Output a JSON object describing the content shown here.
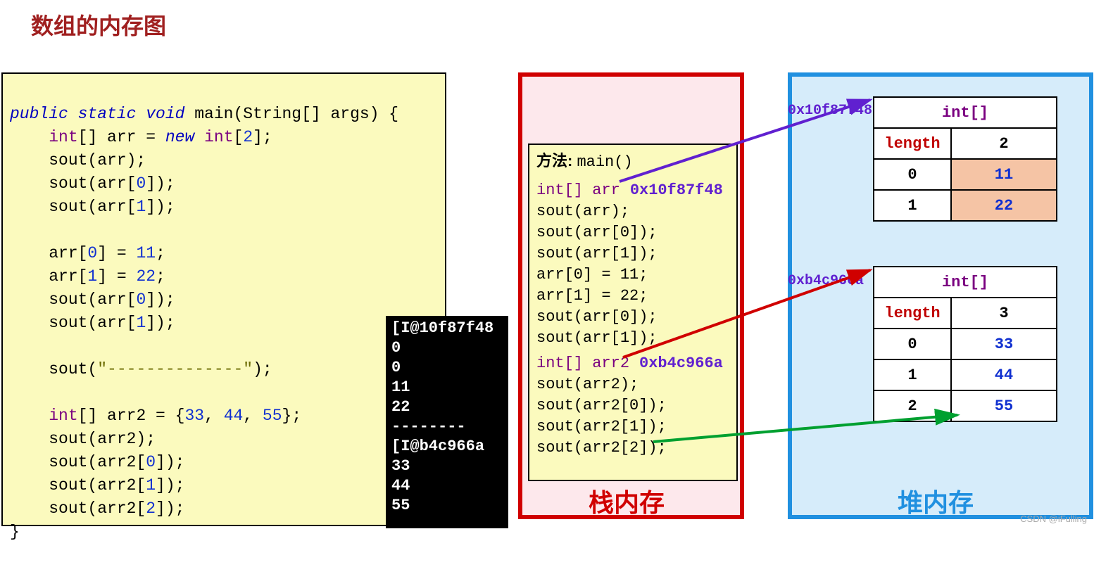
{
  "title": "数组的内存图",
  "code": {
    "l1_kw1": "public static void",
    "l1_rest": " main(String[] args) {",
    "l2_type": "int",
    "l2_mid": "[] arr = ",
    "l2_kw": "new",
    "l2_type2": " int",
    "l2_num": "2",
    "l3": "    sout(arr);",
    "l4a": "    sout(arr[",
    "l4n": "0",
    "l4b": "]);",
    "l5a": "    sout(arr[",
    "l5n": "1",
    "l5b": "]);",
    "l7a": "    arr[",
    "l7n": "0",
    "l7b": "] = ",
    "l7v": "11",
    "l8a": "    arr[",
    "l8n": "1",
    "l8b": "] = ",
    "l8v": "22",
    "l9a": "    sout(arr[",
    "l9n": "0",
    "l9b": "]);",
    "l10a": "    sout(arr[",
    "l10n": "1",
    "l10b": "]);",
    "l12a": "    sout(",
    "l12s": "\"--------------\"",
    "l12b": ");",
    "l14_type": "int",
    "l14_mid": "[] arr2 = {",
    "l14_n1": "33",
    "l14_n2": "44",
    "l14_n3": "55",
    "l14_end": "};",
    "l15": "    sout(arr2);",
    "l16a": "    sout(arr2[",
    "l16n": "0",
    "l16b": "]);",
    "l17a": "    sout(arr2[",
    "l17n": "1",
    "l17b": "]);",
    "l18a": "    sout(arr2[",
    "l18n": "2",
    "l18b": "]);",
    "l19": "}"
  },
  "console": {
    "out": "[I@10f87f48\n0\n0\n11\n22\n--------\n[I@b4c966a\n33\n44\n55"
  },
  "stack": {
    "panel_label": "栈内存",
    "method_label": "方法: ",
    "method_name": "main()",
    "arr_decl": "int[] arr",
    "arr_addr": "0x10f87f48",
    "s_sout_arr": "sout(arr);",
    "s_sout_arr0": "sout(arr[0]);",
    "s_sout_arr1": "sout(arr[1]);",
    "s_assign0": "arr[0] = 11;",
    "s_assign1": "arr[1] = 22;",
    "s_sout_arr0b": "sout(arr[0]);",
    "s_sout_arr1b": "sout(arr[1]);",
    "arr2_decl": "int[] arr2",
    "arr2_addr": "0xb4c966a",
    "s_sout_arr2": "sout(arr2);",
    "s_sout_arr20": "sout(arr2[0]);",
    "s_sout_arr21": "sout(arr2[1]);",
    "s_sout_arr22": "sout(arr2[2]);"
  },
  "heap": {
    "panel_label": "堆内存",
    "arr1_addr": "0x10f87f48",
    "arr2_addr": "0xb4c966a",
    "type_label": "int[]",
    "length_label": "length",
    "arr1": {
      "length": "2",
      "idx": [
        "0",
        "1"
      ],
      "vals": [
        "11",
        "22"
      ]
    },
    "arr2": {
      "length": "3",
      "idx": [
        "0",
        "1",
        "2"
      ],
      "vals": [
        "33",
        "44",
        "55"
      ]
    }
  },
  "watermark": "CSDN @iFulling"
}
